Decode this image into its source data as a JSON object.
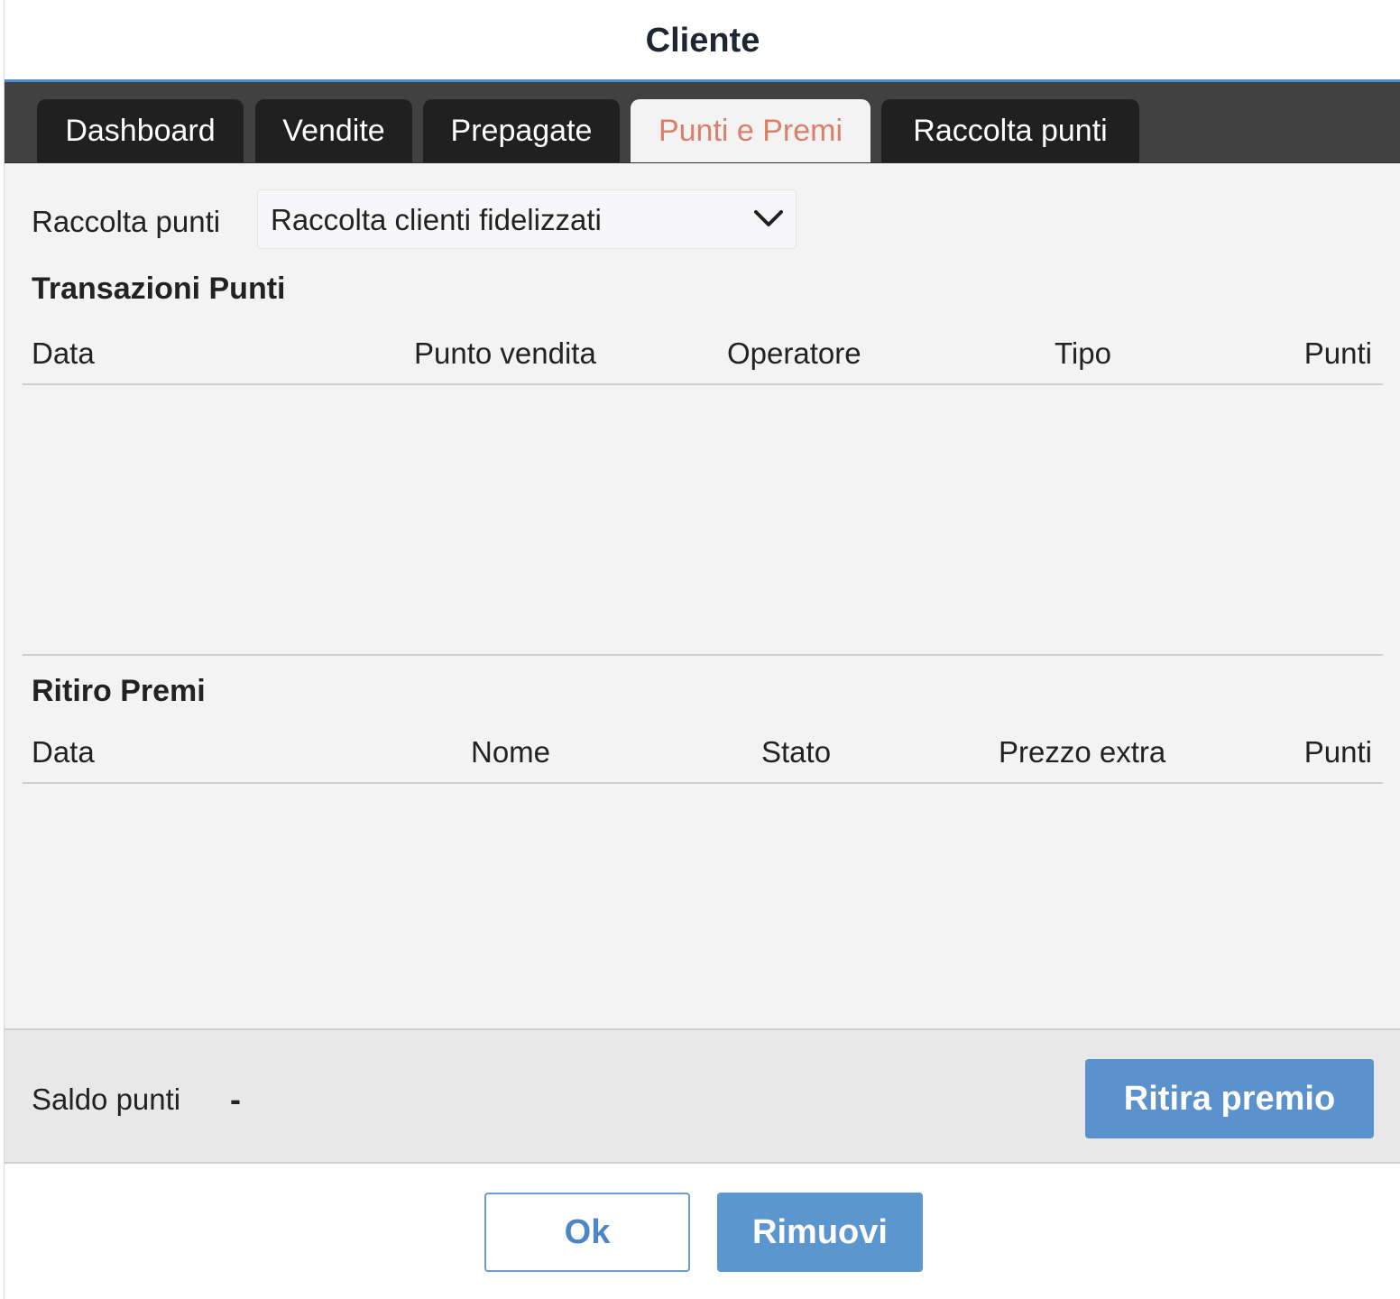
{
  "dialog": {
    "title": "Cliente"
  },
  "tabs": [
    {
      "label": "Dashboard",
      "active": false
    },
    {
      "label": "Vendite",
      "active": false
    },
    {
      "label": "Prepagate",
      "active": false
    },
    {
      "label": "Punti e Premi",
      "active": true
    },
    {
      "label": "Raccolta punti",
      "active": false
    }
  ],
  "selector": {
    "label": "Raccolta punti",
    "value": "Raccolta clienti fidelizzati",
    "icon": "chevron-down-icon"
  },
  "transazioni": {
    "title": "Transazioni Punti",
    "columns": [
      "Data",
      "Punto vendita",
      "Operatore",
      "Tipo",
      "Punti"
    ],
    "rows": []
  },
  "ritiro": {
    "title": "Ritiro Premi",
    "columns": [
      "Data",
      "Nome",
      "Stato",
      "Prezzo extra",
      "Punti"
    ],
    "rows": []
  },
  "footer": {
    "saldo_label": "Saldo punti",
    "saldo_value": "-",
    "ritira_button": "Ritira premio"
  },
  "actions": {
    "ok_label": "Ok",
    "rimuovi_label": "Rimuovi"
  },
  "colors": {
    "accent_blue": "#5b91cd",
    "active_tab_text": "#d9806a",
    "tab_bg": "#202020",
    "tabbar_bg": "#414141",
    "title_underline": "#4a8fd1"
  }
}
